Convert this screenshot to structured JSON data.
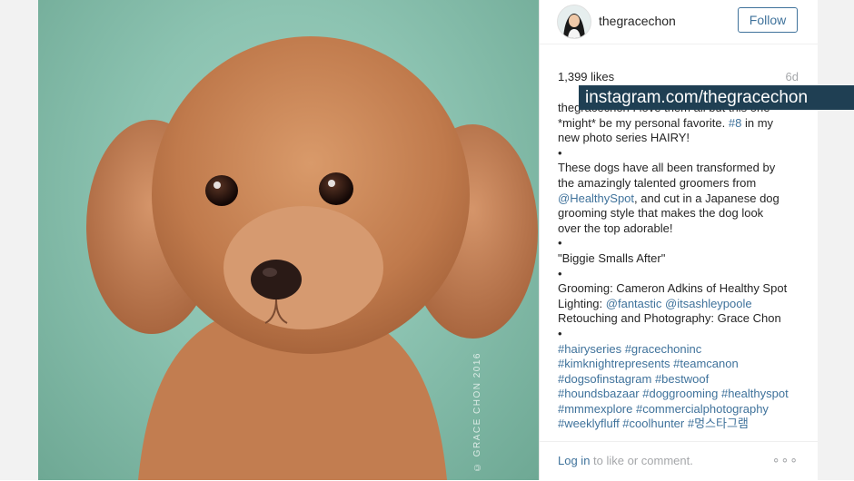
{
  "post": {
    "username": "thegracechon",
    "follow_label": "Follow",
    "likes": "1,399 likes",
    "age": "6d",
    "caption": {
      "l1": "thegracechon I love them all but this one",
      "l2": "*might* be my personal favorite.",
      "l2_tag": "#8",
      "l2_end": "in my",
      "l3": "new photo series HAIRY!",
      "l4": "•",
      "l5": "These dogs have all been transformed by",
      "l6": "the amazingly talented groomers from",
      "l7_mention": "@HealthySpot",
      "l7": ", and cut in a Japanese dog",
      "l8": "grooming style that makes the dog look",
      "l9": "over the top adorable!",
      "l10": "•",
      "l11": "\"Biggie Smalls After\"",
      "l12": "•",
      "l13": "Grooming: Cameron Adkins of Healthy Spot",
      "l14": "Lighting:",
      "l14_m1": "@fantastic",
      "l14_m2": "@itsashleypoole",
      "l15": "Retouching and Photography: Grace Chon",
      "l16": "•",
      "tags": [
        "#hairyseries #gracechoninc",
        "#kimknightrepresents #teamcanon",
        "#dogsofinstagram #bestwoof",
        "#houndsbazaar #doggrooming #healthyspot",
        "#mmmexplore #commercialphotography",
        "#weeklyfluff #coolhunter #멍스타그램"
      ]
    },
    "footer": {
      "login_link": "Log in",
      "login_rest": " to like or comment.",
      "more": "∘∘∘"
    }
  },
  "photo": {
    "watermark": "© GRACE CHON 2016"
  },
  "overlay": {
    "banner_text": "instagram.com/thegracechon"
  },
  "colors": {
    "link": "#3f729b",
    "banner_bg": "#1f3f53",
    "photo_bg": "#8cc3b1"
  }
}
